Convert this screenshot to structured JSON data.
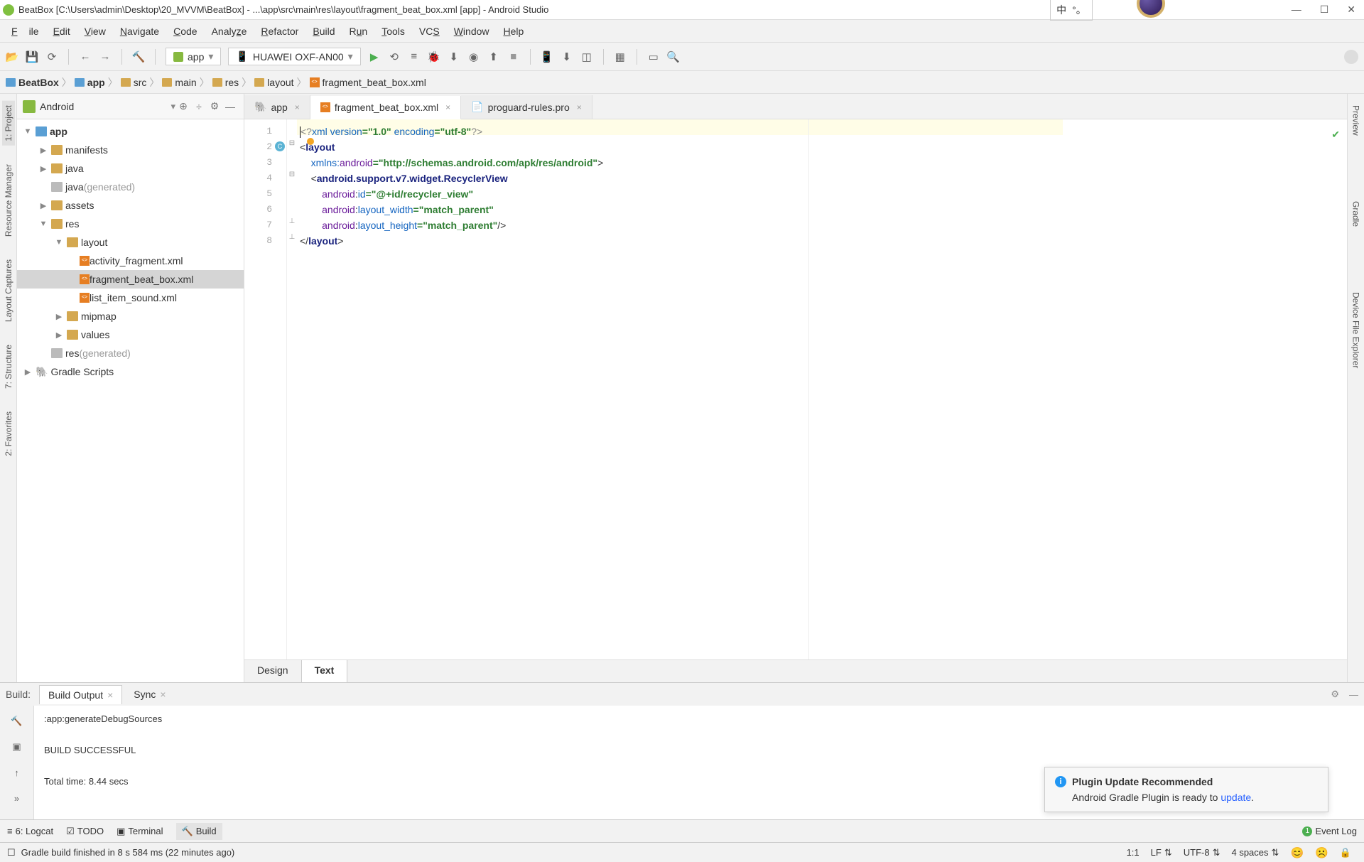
{
  "title_bar": {
    "text": "BeatBox [C:\\Users\\admin\\Desktop\\20_MVVM\\BeatBox] - ...\\app\\src\\main\\res\\layout\\fragment_beat_box.xml [app] - Android Studio",
    "lang1": "中",
    "lang2": "°。"
  },
  "menu": {
    "file": "File",
    "edit": "Edit",
    "view": "View",
    "navigate": "Navigate",
    "code": "Code",
    "analyze": "Analyze",
    "refactor": "Refactor",
    "build": "Build",
    "run": "Run",
    "tools": "Tools",
    "vcs": "VCS",
    "window": "Window",
    "help": "Help"
  },
  "toolbar": {
    "config": "app",
    "device": "HUAWEI OXF-AN00"
  },
  "breadcrumb": {
    "items": [
      "BeatBox",
      "app",
      "src",
      "main",
      "res",
      "layout",
      "fragment_beat_box.xml"
    ]
  },
  "left_strip": {
    "project": "1: Project",
    "resmgr": "Resource Manager",
    "captures": "Layout Captures",
    "structure": "7: Structure",
    "favorites": "2: Favorites"
  },
  "right_strip": {
    "preview": "Preview",
    "gradle": "Gradle",
    "device_explorer": "Device File Explorer"
  },
  "project": {
    "mode": "Android",
    "nodes": {
      "app": "app",
      "manifests": "manifests",
      "java": "java",
      "java_gen": "java",
      "gen_suffix": "(generated)",
      "assets": "assets",
      "res": "res",
      "layout": "layout",
      "activity_fragment": "activity_fragment.xml",
      "fragment_beat_box": "fragment_beat_box.xml",
      "list_item_sound": "list_item_sound.xml",
      "mipmap": "mipmap",
      "values": "values",
      "res_gen": "res",
      "gradle_scripts": "Gradle Scripts"
    }
  },
  "editor": {
    "tabs": {
      "app": "app",
      "fragment": "fragment_beat_box.xml",
      "proguard": "proguard-rules.pro"
    },
    "design_tabs": {
      "design": "Design",
      "text": "Text"
    },
    "code": {
      "l1_a": "<?",
      "l1_b": "xml version",
      "l1_c": "=\"1.0\"",
      "l1_d": " encoding",
      "l1_e": "=\"utf-8\"",
      "l1_f": "?>",
      "l2": "layout",
      "l3_a": "xmlns:",
      "l3_b": "android",
      "l3_c": "=\"http://schemas.android.com/apk/res/android\"",
      "l3_d": ">",
      "l4_a": "<",
      "l4_b": "android.support.v7.widget.RecyclerView",
      "l5_a": "android",
      ":": ":",
      "l5_b": "id",
      "l5_c": "=\"@+id/recycler_view\"",
      "l6_a": "android",
      "l6_b": "layout_width",
      "l6_c": "=\"match_parent\"",
      "l7_a": "android",
      "l7_b": "layout_height",
      "l7_c": "=\"match_parent\"",
      "l7_d": "/>",
      "l8_a": "</",
      "l8_b": "layout",
      "l8_c": ">"
    }
  },
  "build": {
    "label": "Build:",
    "tabs": {
      "output": "Build Output",
      "sync": "Sync"
    },
    "line1": ":app:generateDebugSources",
    "line2": "BUILD SUCCESSFUL",
    "line3": "Total time: 8.44 secs"
  },
  "notification": {
    "title": "Plugin Update Recommended",
    "body_pre": "Android Gradle Plugin is ready to ",
    "link": "update",
    "body_post": "."
  },
  "bottom_tools": {
    "logcat": "6: Logcat",
    "todo": "TODO",
    "terminal": "Terminal",
    "build": "Build",
    "eventlog": "Event Log"
  },
  "status": {
    "msg": "Gradle build finished in 8 s 584 ms (22 minutes ago)",
    "pos": "1:1",
    "le": "LF",
    "enc": "UTF-8",
    "indent": "4 spaces"
  }
}
